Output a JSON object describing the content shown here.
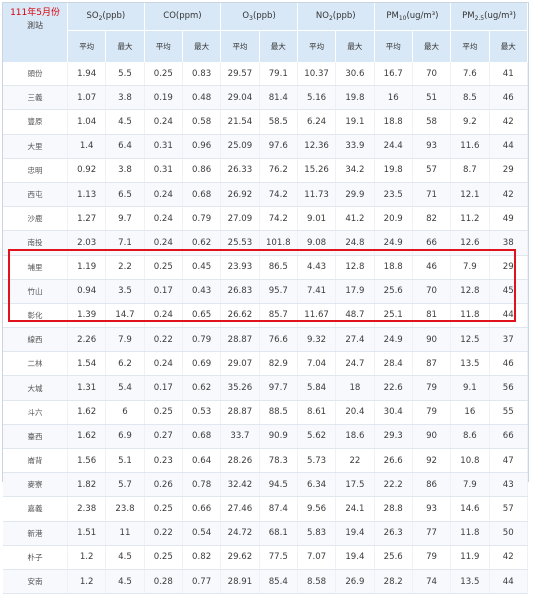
{
  "header": {
    "month": "111年5月份",
    "station_label": "測站",
    "pollutants": [
      {
        "pre": "SO",
        "sub": "2",
        "post": "(ppb)"
      },
      {
        "pre": "CO(ppm)",
        "sub": "",
        "post": ""
      },
      {
        "pre": "O",
        "sub": "3",
        "post": "(ppb)"
      },
      {
        "pre": "NO",
        "sub": "2",
        "post": "(ppb)"
      },
      {
        "pre": "PM",
        "sub": "10",
        "post": "(ug/m³)"
      },
      {
        "pre": "PM",
        "sub": "2.5",
        "post": "(ug/m³)"
      }
    ],
    "avg_label": "平均",
    "max_label": "最大"
  },
  "rows": [
    {
      "station": "頭份",
      "v": [
        "1.94",
        "5.5",
        "0.25",
        "0.83",
        "29.57",
        "79.1",
        "10.37",
        "30.6",
        "16.7",
        "70",
        "7.6",
        "41"
      ]
    },
    {
      "station": "三義",
      "v": [
        "1.07",
        "3.8",
        "0.19",
        "0.48",
        "29.04",
        "81.4",
        "5.16",
        "19.8",
        "16",
        "51",
        "8.5",
        "46"
      ]
    },
    {
      "station": "豐原",
      "v": [
        "1.04",
        "4.5",
        "0.24",
        "0.58",
        "21.54",
        "58.5",
        "6.24",
        "19.1",
        "18.8",
        "58",
        "9.2",
        "42"
      ]
    },
    {
      "station": "大里",
      "v": [
        "1.4",
        "6.4",
        "0.31",
        "0.96",
        "25.09",
        "97.6",
        "12.36",
        "33.9",
        "24.4",
        "93",
        "11.6",
        "44"
      ]
    },
    {
      "station": "忠明",
      "v": [
        "0.92",
        "3.8",
        "0.31",
        "0.86",
        "26.33",
        "76.2",
        "15.26",
        "34.2",
        "19.8",
        "57",
        "8.7",
        "29"
      ]
    },
    {
      "station": "西屯",
      "v": [
        "1.13",
        "6.5",
        "0.24",
        "0.68",
        "26.92",
        "74.2",
        "11.73",
        "29.9",
        "23.5",
        "71",
        "12.1",
        "42"
      ]
    },
    {
      "station": "沙鹿",
      "v": [
        "1.27",
        "9.7",
        "0.24",
        "0.79",
        "27.09",
        "74.2",
        "9.01",
        "41.2",
        "20.9",
        "82",
        "11.2",
        "49"
      ]
    },
    {
      "station": "南投",
      "v": [
        "2.03",
        "7.1",
        "0.24",
        "0.62",
        "25.53",
        "101.8",
        "9.08",
        "24.8",
        "24.9",
        "66",
        "12.6",
        "38"
      ]
    },
    {
      "station": "埔里",
      "v": [
        "1.19",
        "2.2",
        "0.25",
        "0.45",
        "23.93",
        "86.5",
        "4.43",
        "12.8",
        "18.8",
        "46",
        "7.9",
        "29"
      ]
    },
    {
      "station": "竹山",
      "v": [
        "0.94",
        "3.5",
        "0.17",
        "0.43",
        "26.83",
        "95.7",
        "7.41",
        "17.9",
        "25.6",
        "70",
        "12.8",
        "45"
      ]
    },
    {
      "station": "彰化",
      "v": [
        "1.39",
        "14.7",
        "0.24",
        "0.65",
        "26.62",
        "85.7",
        "11.67",
        "48.7",
        "25.1",
        "81",
        "11.8",
        "44"
      ]
    },
    {
      "station": "線西",
      "v": [
        "2.26",
        "7.9",
        "0.22",
        "0.79",
        "28.87",
        "76.6",
        "9.32",
        "27.4",
        "24.9",
        "90",
        "12.5",
        "37"
      ]
    },
    {
      "station": "二林",
      "v": [
        "1.54",
        "6.2",
        "0.24",
        "0.69",
        "29.07",
        "82.9",
        "7.04",
        "24.7",
        "28.4",
        "87",
        "13.5",
        "46"
      ]
    },
    {
      "station": "大城",
      "v": [
        "1.31",
        "5.4",
        "0.17",
        "0.62",
        "35.26",
        "97.7",
        "5.84",
        "18",
        "22.6",
        "79",
        "9.1",
        "56"
      ]
    },
    {
      "station": "斗六",
      "v": [
        "1.62",
        "6",
        "0.25",
        "0.53",
        "28.87",
        "88.5",
        "8.61",
        "20.4",
        "30.4",
        "79",
        "16",
        "55"
      ]
    },
    {
      "station": "臺西",
      "v": [
        "1.62",
        "6.9",
        "0.27",
        "0.68",
        "33.7",
        "90.9",
        "5.62",
        "18.6",
        "29.3",
        "90",
        "8.6",
        "66"
      ]
    },
    {
      "station": "崙背",
      "v": [
        "1.56",
        "5.1",
        "0.23",
        "0.64",
        "28.26",
        "78.3",
        "5.73",
        "22",
        "26.6",
        "92",
        "10.8",
        "47"
      ]
    },
    {
      "station": "麥寮",
      "v": [
        "1.82",
        "5.7",
        "0.26",
        "0.78",
        "32.42",
        "94.5",
        "6.34",
        "17.5",
        "22.2",
        "86",
        "7.9",
        "43"
      ]
    },
    {
      "station": "嘉義",
      "v": [
        "2.38",
        "23.8",
        "0.25",
        "0.66",
        "27.46",
        "87.4",
        "9.56",
        "24.1",
        "28.8",
        "93",
        "14.6",
        "57"
      ]
    },
    {
      "station": "新港",
      "v": [
        "1.51",
        "11",
        "0.22",
        "0.54",
        "24.72",
        "68.1",
        "5.83",
        "19.4",
        "26.3",
        "77",
        "11.8",
        "50"
      ]
    },
    {
      "station": "朴子",
      "v": [
        "1.2",
        "4.5",
        "0.25",
        "0.82",
        "29.62",
        "77.5",
        "7.07",
        "19.4",
        "25.6",
        "79",
        "11.9",
        "42"
      ]
    },
    {
      "station": "安南",
      "v": [
        "1.2",
        "4.5",
        "0.28",
        "0.77",
        "28.91",
        "85.4",
        "8.58",
        "26.9",
        "28.2",
        "74",
        "13.5",
        "44"
      ]
    }
  ],
  "highlight": {
    "color": "#e0121c"
  }
}
